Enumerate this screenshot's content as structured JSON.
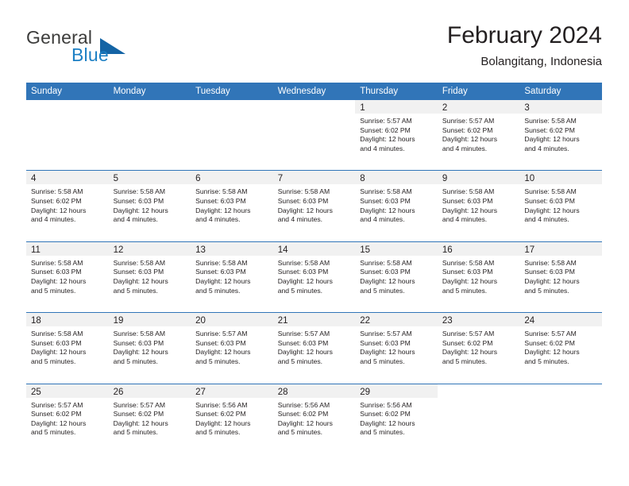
{
  "brand": {
    "name_top": "General",
    "name_bottom": "Blue",
    "triangle_color": "#1464a5",
    "blue_color": "#1c7fc4",
    "gray_color": "#3c3c3b"
  },
  "header": {
    "title": "February 2024",
    "subtitle": "Bolangitang, Indonesia"
  },
  "theme": {
    "header_blue": "#3175b8",
    "daynum_strip_gray": "#f1f1f1",
    "text_color": "#231f20",
    "page_background": "#ffffff"
  },
  "day_headers": [
    "Sunday",
    "Monday",
    "Tuesday",
    "Wednesday",
    "Thursday",
    "Friday",
    "Saturday"
  ],
  "weeks": [
    {
      "days": [
        {
          "num": "",
          "empty": true,
          "sunrise": "",
          "sunset": "",
          "daylight_1": "",
          "daylight_2": ""
        },
        {
          "num": "",
          "empty": true,
          "sunrise": "",
          "sunset": "",
          "daylight_1": "",
          "daylight_2": ""
        },
        {
          "num": "",
          "empty": true,
          "sunrise": "",
          "sunset": "",
          "daylight_1": "",
          "daylight_2": ""
        },
        {
          "num": "",
          "empty": true,
          "sunrise": "",
          "sunset": "",
          "daylight_1": "",
          "daylight_2": ""
        },
        {
          "num": "1",
          "empty": false,
          "sunrise": "Sunrise: 5:57 AM",
          "sunset": "Sunset: 6:02 PM",
          "daylight_1": "Daylight: 12 hours",
          "daylight_2": "and 4 minutes."
        },
        {
          "num": "2",
          "empty": false,
          "sunrise": "Sunrise: 5:57 AM",
          "sunset": "Sunset: 6:02 PM",
          "daylight_1": "Daylight: 12 hours",
          "daylight_2": "and 4 minutes."
        },
        {
          "num": "3",
          "empty": false,
          "sunrise": "Sunrise: 5:58 AM",
          "sunset": "Sunset: 6:02 PM",
          "daylight_1": "Daylight: 12 hours",
          "daylight_2": "and 4 minutes."
        }
      ]
    },
    {
      "days": [
        {
          "num": "4",
          "empty": false,
          "sunrise": "Sunrise: 5:58 AM",
          "sunset": "Sunset: 6:02 PM",
          "daylight_1": "Daylight: 12 hours",
          "daylight_2": "and 4 minutes."
        },
        {
          "num": "5",
          "empty": false,
          "sunrise": "Sunrise: 5:58 AM",
          "sunset": "Sunset: 6:03 PM",
          "daylight_1": "Daylight: 12 hours",
          "daylight_2": "and 4 minutes."
        },
        {
          "num": "6",
          "empty": false,
          "sunrise": "Sunrise: 5:58 AM",
          "sunset": "Sunset: 6:03 PM",
          "daylight_1": "Daylight: 12 hours",
          "daylight_2": "and 4 minutes."
        },
        {
          "num": "7",
          "empty": false,
          "sunrise": "Sunrise: 5:58 AM",
          "sunset": "Sunset: 6:03 PM",
          "daylight_1": "Daylight: 12 hours",
          "daylight_2": "and 4 minutes."
        },
        {
          "num": "8",
          "empty": false,
          "sunrise": "Sunrise: 5:58 AM",
          "sunset": "Sunset: 6:03 PM",
          "daylight_1": "Daylight: 12 hours",
          "daylight_2": "and 4 minutes."
        },
        {
          "num": "9",
          "empty": false,
          "sunrise": "Sunrise: 5:58 AM",
          "sunset": "Sunset: 6:03 PM",
          "daylight_1": "Daylight: 12 hours",
          "daylight_2": "and 4 minutes."
        },
        {
          "num": "10",
          "empty": false,
          "sunrise": "Sunrise: 5:58 AM",
          "sunset": "Sunset: 6:03 PM",
          "daylight_1": "Daylight: 12 hours",
          "daylight_2": "and 4 minutes."
        }
      ]
    },
    {
      "days": [
        {
          "num": "11",
          "empty": false,
          "sunrise": "Sunrise: 5:58 AM",
          "sunset": "Sunset: 6:03 PM",
          "daylight_1": "Daylight: 12 hours",
          "daylight_2": "and 5 minutes."
        },
        {
          "num": "12",
          "empty": false,
          "sunrise": "Sunrise: 5:58 AM",
          "sunset": "Sunset: 6:03 PM",
          "daylight_1": "Daylight: 12 hours",
          "daylight_2": "and 5 minutes."
        },
        {
          "num": "13",
          "empty": false,
          "sunrise": "Sunrise: 5:58 AM",
          "sunset": "Sunset: 6:03 PM",
          "daylight_1": "Daylight: 12 hours",
          "daylight_2": "and 5 minutes."
        },
        {
          "num": "14",
          "empty": false,
          "sunrise": "Sunrise: 5:58 AM",
          "sunset": "Sunset: 6:03 PM",
          "daylight_1": "Daylight: 12 hours",
          "daylight_2": "and 5 minutes."
        },
        {
          "num": "15",
          "empty": false,
          "sunrise": "Sunrise: 5:58 AM",
          "sunset": "Sunset: 6:03 PM",
          "daylight_1": "Daylight: 12 hours",
          "daylight_2": "and 5 minutes."
        },
        {
          "num": "16",
          "empty": false,
          "sunrise": "Sunrise: 5:58 AM",
          "sunset": "Sunset: 6:03 PM",
          "daylight_1": "Daylight: 12 hours",
          "daylight_2": "and 5 minutes."
        },
        {
          "num": "17",
          "empty": false,
          "sunrise": "Sunrise: 5:58 AM",
          "sunset": "Sunset: 6:03 PM",
          "daylight_1": "Daylight: 12 hours",
          "daylight_2": "and 5 minutes."
        }
      ]
    },
    {
      "days": [
        {
          "num": "18",
          "empty": false,
          "sunrise": "Sunrise: 5:58 AM",
          "sunset": "Sunset: 6:03 PM",
          "daylight_1": "Daylight: 12 hours",
          "daylight_2": "and 5 minutes."
        },
        {
          "num": "19",
          "empty": false,
          "sunrise": "Sunrise: 5:58 AM",
          "sunset": "Sunset: 6:03 PM",
          "daylight_1": "Daylight: 12 hours",
          "daylight_2": "and 5 minutes."
        },
        {
          "num": "20",
          "empty": false,
          "sunrise": "Sunrise: 5:57 AM",
          "sunset": "Sunset: 6:03 PM",
          "daylight_1": "Daylight: 12 hours",
          "daylight_2": "and 5 minutes."
        },
        {
          "num": "21",
          "empty": false,
          "sunrise": "Sunrise: 5:57 AM",
          "sunset": "Sunset: 6:03 PM",
          "daylight_1": "Daylight: 12 hours",
          "daylight_2": "and 5 minutes."
        },
        {
          "num": "22",
          "empty": false,
          "sunrise": "Sunrise: 5:57 AM",
          "sunset": "Sunset: 6:03 PM",
          "daylight_1": "Daylight: 12 hours",
          "daylight_2": "and 5 minutes."
        },
        {
          "num": "23",
          "empty": false,
          "sunrise": "Sunrise: 5:57 AM",
          "sunset": "Sunset: 6:02 PM",
          "daylight_1": "Daylight: 12 hours",
          "daylight_2": "and 5 minutes."
        },
        {
          "num": "24",
          "empty": false,
          "sunrise": "Sunrise: 5:57 AM",
          "sunset": "Sunset: 6:02 PM",
          "daylight_1": "Daylight: 12 hours",
          "daylight_2": "and 5 minutes."
        }
      ]
    },
    {
      "days": [
        {
          "num": "25",
          "empty": false,
          "sunrise": "Sunrise: 5:57 AM",
          "sunset": "Sunset: 6:02 PM",
          "daylight_1": "Daylight: 12 hours",
          "daylight_2": "and 5 minutes."
        },
        {
          "num": "26",
          "empty": false,
          "sunrise": "Sunrise: 5:57 AM",
          "sunset": "Sunset: 6:02 PM",
          "daylight_1": "Daylight: 12 hours",
          "daylight_2": "and 5 minutes."
        },
        {
          "num": "27",
          "empty": false,
          "sunrise": "Sunrise: 5:56 AM",
          "sunset": "Sunset: 6:02 PM",
          "daylight_1": "Daylight: 12 hours",
          "daylight_2": "and 5 minutes."
        },
        {
          "num": "28",
          "empty": false,
          "sunrise": "Sunrise: 5:56 AM",
          "sunset": "Sunset: 6:02 PM",
          "daylight_1": "Daylight: 12 hours",
          "daylight_2": "and 5 minutes."
        },
        {
          "num": "29",
          "empty": false,
          "sunrise": "Sunrise: 5:56 AM",
          "sunset": "Sunset: 6:02 PM",
          "daylight_1": "Daylight: 12 hours",
          "daylight_2": "and 5 minutes."
        },
        {
          "num": "",
          "empty": true,
          "sunrise": "",
          "sunset": "",
          "daylight_1": "",
          "daylight_2": ""
        },
        {
          "num": "",
          "empty": true,
          "sunrise": "",
          "sunset": "",
          "daylight_1": "",
          "daylight_2": ""
        }
      ]
    }
  ]
}
